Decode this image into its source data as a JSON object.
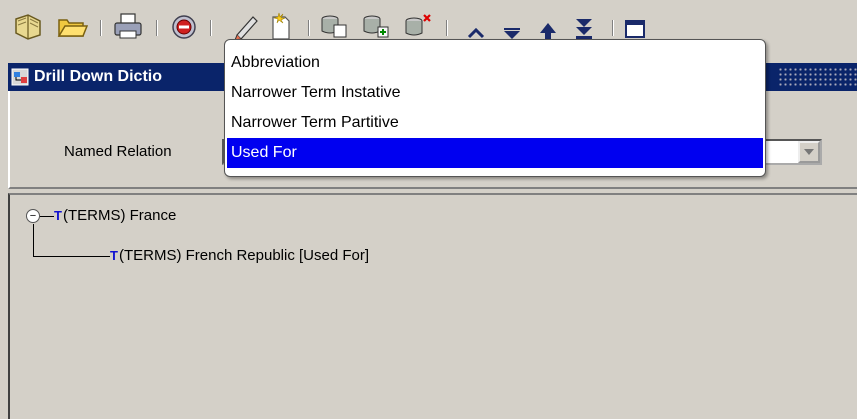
{
  "toolbar": {
    "buttons": [
      {
        "name": "open-book-icon"
      },
      {
        "name": "open-folder-icon"
      },
      {
        "name": "print-icon"
      },
      {
        "name": "stop-icon"
      },
      {
        "name": "edit-icon"
      },
      {
        "name": "new-icon"
      },
      {
        "name": "db-copy-icon"
      },
      {
        "name": "db-refresh-icon"
      },
      {
        "name": "db-delete-icon"
      },
      {
        "name": "first-record-icon"
      },
      {
        "name": "last-record-icon"
      },
      {
        "name": "previous-record-icon"
      },
      {
        "name": "next-record-icon"
      },
      {
        "name": "window-icon"
      }
    ]
  },
  "window": {
    "title": "Drill Down Dictio"
  },
  "form": {
    "named_relation_label": "Named Relation",
    "named_relation_value": "Used For"
  },
  "dropdown": {
    "options": [
      "Abbreviation",
      "Narrower Term Instative",
      "Narrower Term Partitive",
      "Used For"
    ],
    "selected_index": 3
  },
  "tree": {
    "root": {
      "marker": "T",
      "label": "(TERMS) France",
      "expanded": true
    },
    "children": [
      {
        "marker": "T",
        "label": "(TERMS) French Republic [Used For]"
      }
    ]
  },
  "colors": {
    "title_bar": "#0a246a",
    "selection": "#0000f0",
    "tree_marker": "#1010d0",
    "background": "#d4d0c8"
  }
}
